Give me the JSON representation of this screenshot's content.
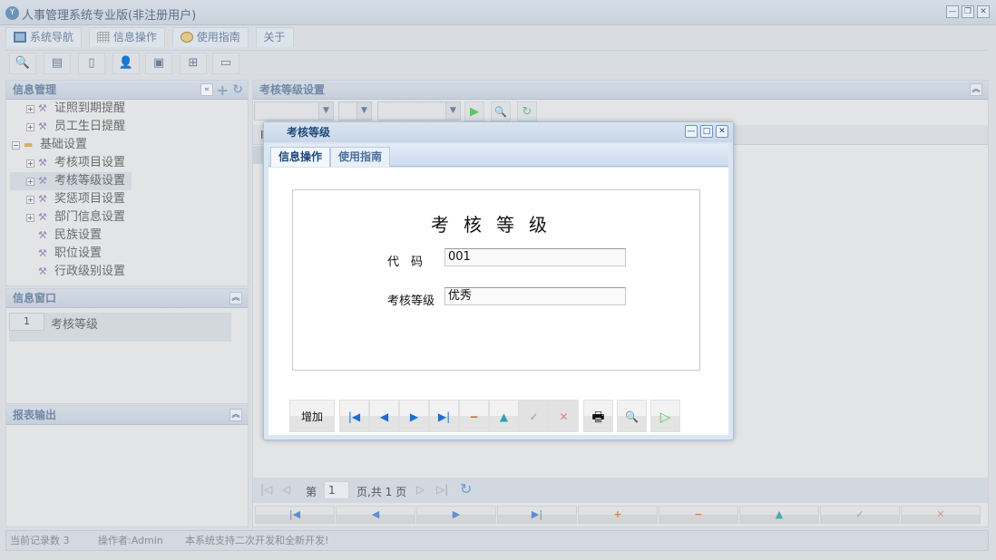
{
  "app": {
    "title": "人事管理系统专业版(非注册用户)",
    "logo": "YF"
  },
  "menu_tabs": [
    {
      "label": "系统导航",
      "icon": "monitor-icon"
    },
    {
      "label": "信息操作",
      "icon": "grid-icon"
    },
    {
      "label": "使用指南",
      "icon": "help-icon"
    },
    {
      "label": "关于"
    }
  ],
  "left": {
    "info_mgmt": "信息管理",
    "tree": [
      {
        "label": "证照到期提醒",
        "level": 1,
        "expandable": true
      },
      {
        "label": "员工生日提醒",
        "level": 1,
        "expandable": true
      },
      {
        "label": "基础设置",
        "level": 0,
        "folder": true
      },
      {
        "label": "考核项目设置",
        "level": 1,
        "expandable": true
      },
      {
        "label": "考核等级设置",
        "level": 1,
        "expandable": true,
        "selected": true
      },
      {
        "label": "奖惩项目设置",
        "level": 1,
        "expandable": true
      },
      {
        "label": "部门信息设置",
        "level": 1,
        "expandable": true
      },
      {
        "label": "民族设置",
        "level": 1
      },
      {
        "label": "职位设置",
        "level": 1
      },
      {
        "label": "行政级别设置",
        "level": 1
      }
    ],
    "info_window": "信息窗口",
    "window_list": [
      {
        "num": "1",
        "label": "考核等级"
      }
    ],
    "report": "报表输出"
  },
  "right": {
    "title": "考核等级设置",
    "grid_header_first": "I",
    "pager": {
      "page_prefix": "第",
      "page": "1",
      "page_suffix": "页,共 1 页"
    }
  },
  "status": {
    "records": "当前记录数 3",
    "operator": "操作者:Admin",
    "notice": "本系统支持二次开发和全新开发!"
  },
  "dialog": {
    "title": "考核等级",
    "tabs": [
      "信息操作",
      "使用指南"
    ],
    "form_title": "考核等级",
    "fields": [
      {
        "label": "代　码",
        "value": "001"
      },
      {
        "label": "考核等级",
        "value": "优秀"
      }
    ],
    "add_label": "增加"
  }
}
